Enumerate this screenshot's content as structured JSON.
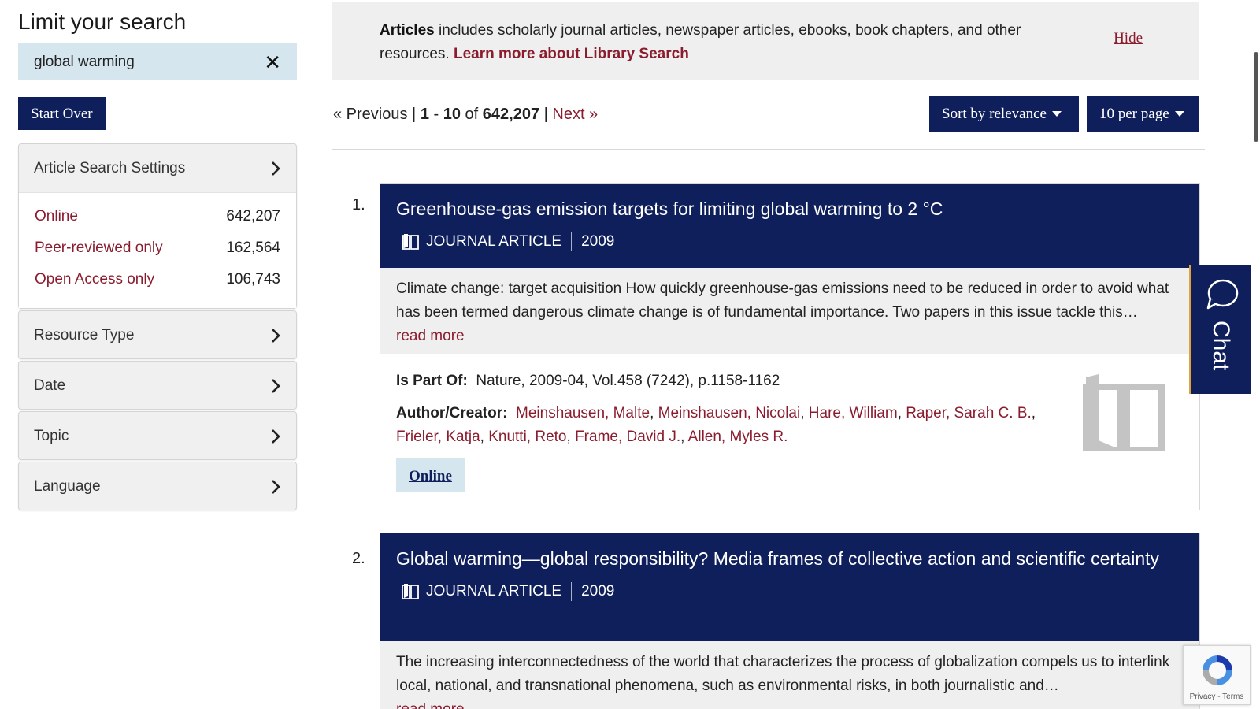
{
  "sidebar": {
    "heading": "Limit your search",
    "constraint": {
      "query": "global warming",
      "remove_glyph": "✕"
    },
    "start_over": "Start Over",
    "open_facet": {
      "title": "Article Search Settings",
      "items": [
        {
          "label": "Online",
          "count": "642,207"
        },
        {
          "label": "Peer-reviewed only",
          "count": "162,564"
        },
        {
          "label": "Open Access only",
          "count": "106,743"
        }
      ]
    },
    "facets": [
      {
        "title": "Resource Type"
      },
      {
        "title": "Date"
      },
      {
        "title": "Topic"
      },
      {
        "title": "Language"
      }
    ]
  },
  "info": {
    "bold": "Articles",
    "text": " includes scholarly journal articles, newspaper articles, ebooks, book chapters, and other resources. ",
    "link": "Learn more about Library Search",
    "hide": "Hide"
  },
  "pager": {
    "previous": "« Previous",
    "sep1": " | ",
    "start": "1",
    "dash": " - ",
    "end": "10",
    "of": " of ",
    "total": "642,207",
    "sep2": " | ",
    "next": "Next »"
  },
  "sort": {
    "label": "Sort by relevance"
  },
  "per_page": {
    "label": "10 per page"
  },
  "results": [
    {
      "num": "1.",
      "title": "Greenhouse-gas emission targets for limiting global warming to 2 °C",
      "type": "JOURNAL ARTICLE",
      "year": "2009",
      "snippet": "Climate change: target acquisition How quickly greenhouse-gas emissions need to be reduced in order to avoid what has been termed dangerous climate change is of fundamental importance. Two papers in this issue tackle this question.",
      "read_more": "read more",
      "part_of_label": "Is Part Of:",
      "part_of": "Nature, 2009-04, Vol.458 (7242), p.1158-1162",
      "author_label": "Author/Creator:",
      "authors": [
        "Meinshausen, Malte",
        "Meinshausen, Nicolai",
        "Hare, William",
        "Raper, Sarah C. B.",
        "Frieler, Katja",
        "Knutti, Reto",
        "Frame, David J.",
        "Allen, Myles R."
      ],
      "online": "Online"
    },
    {
      "num": "2.",
      "title": "Global warming—global responsibility? Media frames of collective action and scientific certainty",
      "type": "JOURNAL ARTICLE",
      "year": "2009",
      "snippet": "The increasing interconnectedness of the world that characterizes the process of globalization compels us to interlink local, national, and transnational phenomena, such as environmental risks, in both journalistic and…",
      "read_more": "read more"
    }
  ],
  "chat": {
    "label": "Chat"
  },
  "recaptcha": {
    "terms": "Privacy - Terms"
  },
  "colors": {
    "navy": "#0f1f5c",
    "maroon": "#8a1c2e",
    "light_blue": "#d6e6ef",
    "grey_bg": "#efefef",
    "chat_accent": "#e0a23a"
  },
  "icons": [
    "close-icon",
    "chevron-right-icon",
    "book-icon",
    "chat-bubble-icon",
    "recaptcha-icon",
    "caret-down-icon"
  ]
}
